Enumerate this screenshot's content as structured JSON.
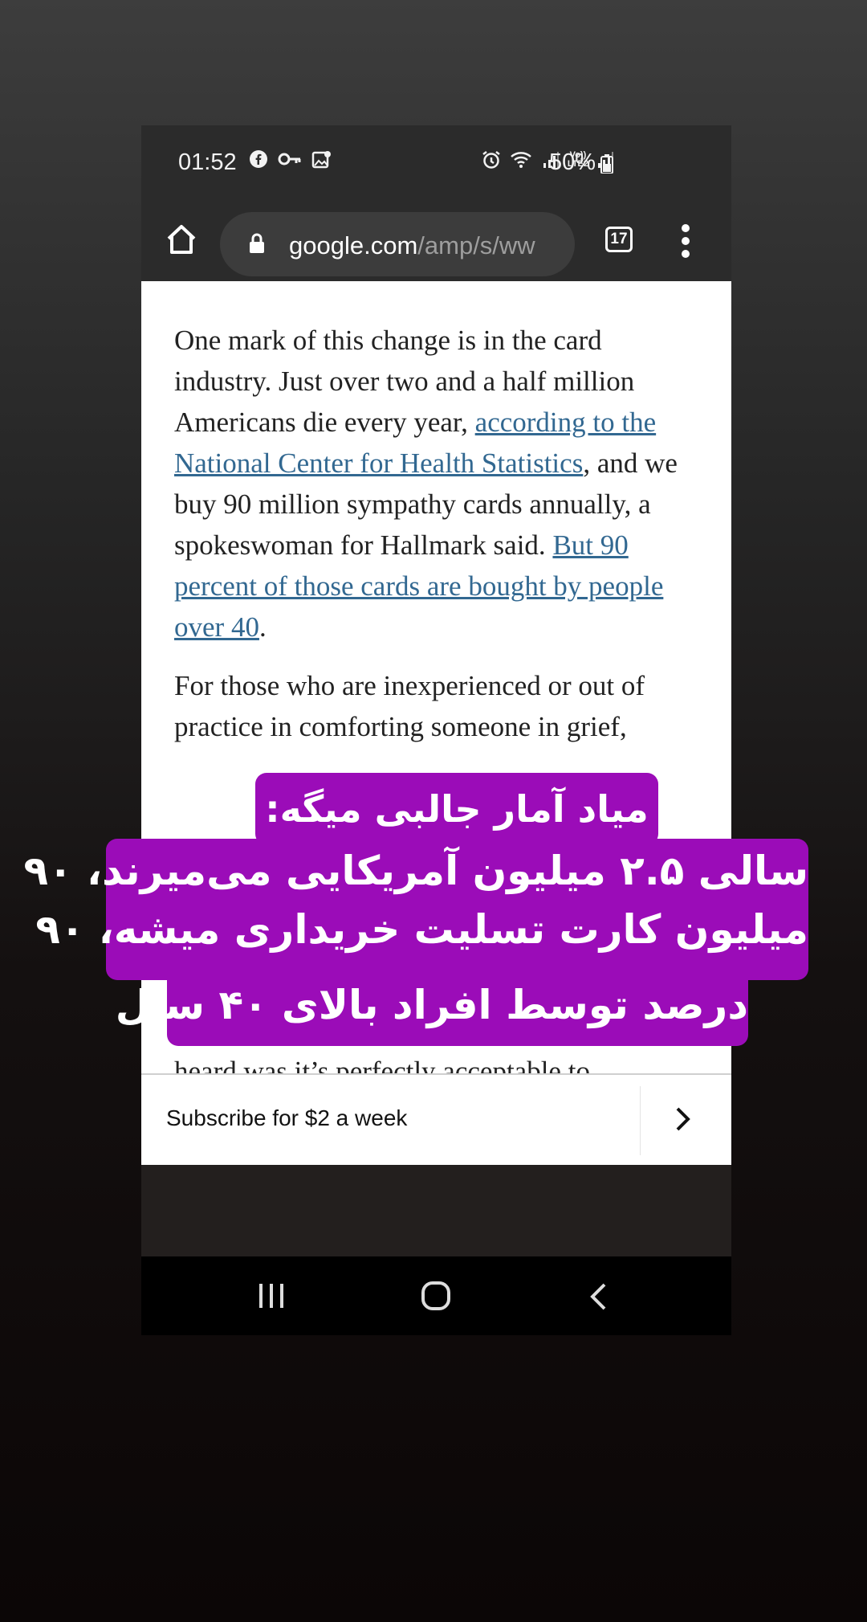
{
  "status_bar": {
    "time": "01:52",
    "battery": "50%",
    "icons": [
      "facebook-icon",
      "key-icon",
      "gallery-icon",
      "alarm-icon",
      "wifi-icon",
      "signal-icon",
      "volte-icon",
      "signal-icon"
    ],
    "volte_label": "Vo))",
    "lte_label": "LTE2"
  },
  "browser": {
    "url_domain": "google.com",
    "url_path": "/amp/s/ww",
    "tab_count": "17"
  },
  "article": {
    "p1_text_1": "One mark of this change is in the card industry. Just over two and a half million Americans die every year, ",
    "p1_link_1": "according to the National Center for Health Statistics",
    "p1_text_2": ", and we buy 90 million sympathy cards annually, a spokeswoman for Hallmark said. ",
    "p1_link_2": "But 90 percent of those cards are bought by people over 40",
    "p1_text_3": ".",
    "p2_visible_1": "For those who are inexperienced or out of practice in comforting someone in grief, ",
    "p2_visible_2": "heard was it’s perfectly acceptable to"
  },
  "subscribe": {
    "label": "Subscribe for $2 a week"
  },
  "caption": {
    "line1": "میاد آمار جالبی میگه:",
    "line2": "سالی ۲.۵ میلیون آمریکایی می‌میرند، ۹۰",
    "line3": "میلیون کارت تسلیت خریداری میشه، ۹۰",
    "line4": "درصد توسط افراد بالای ۴۰ سال"
  },
  "colors": {
    "caption_bg": "#9b0cb8",
    "link": "#326891",
    "browser_bar": "#2b2b2b"
  }
}
